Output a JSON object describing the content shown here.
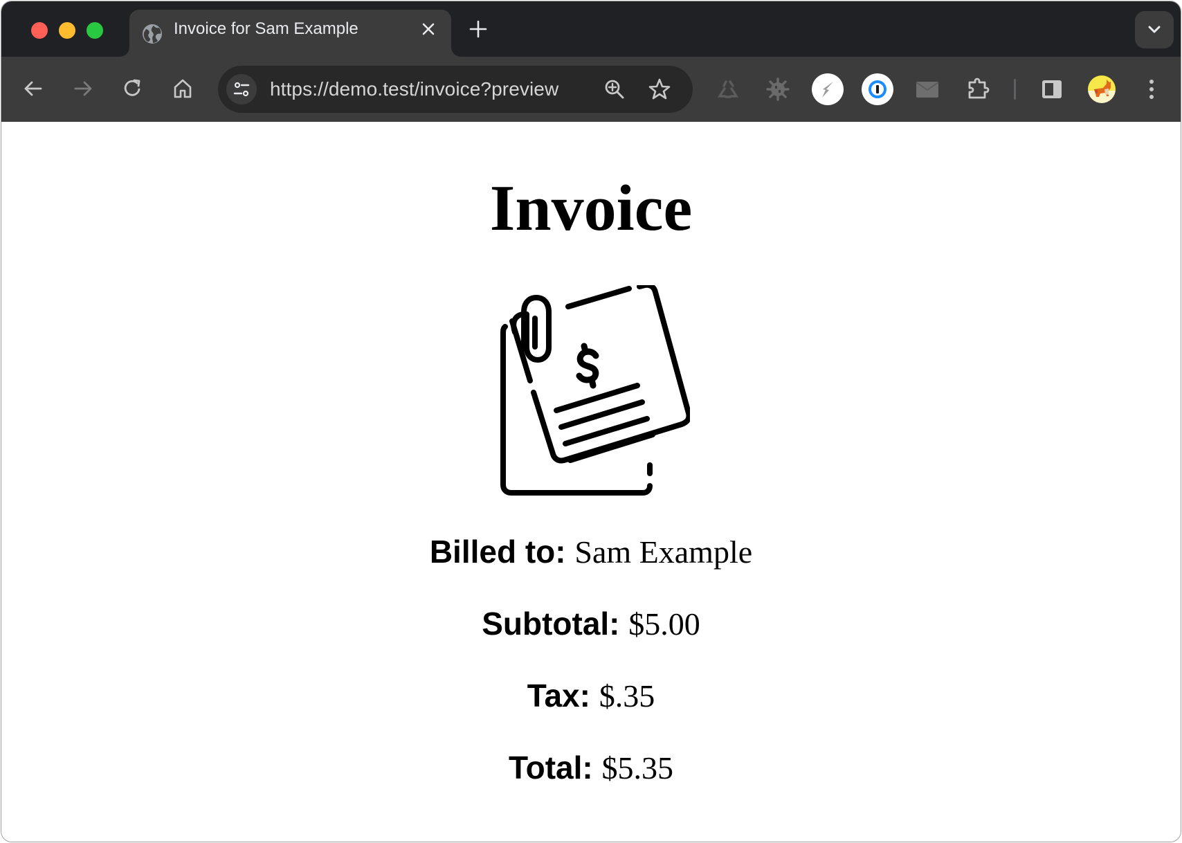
{
  "browser": {
    "tab": {
      "title": "Invoice for Sam Example",
      "favicon": "globe-icon",
      "close_glyph": "✕"
    },
    "new_tab_glyph": "+",
    "toolbar": {
      "back": "arrow-left-icon",
      "forward": "arrow-right-icon",
      "reload": "reload-icon",
      "home": "home-icon"
    },
    "omnibox": {
      "url": "https://demo.test/invoice?preview",
      "site_info_icon": "tune-icon",
      "zoom_icon": "zoom-in-icon",
      "bookmark_icon": "star-icon"
    },
    "extensions": [
      {
        "name": "recycle-extension",
        "icon": "recycle-icon"
      },
      {
        "name": "bug-extension",
        "icon": "bug-icon"
      },
      {
        "name": "lightning-extension",
        "icon": "lightning-icon"
      },
      {
        "name": "password-manager-extension",
        "icon": "onepassword-icon"
      },
      {
        "name": "mail-extension",
        "icon": "mail-icon"
      },
      {
        "name": "extensions-menu",
        "icon": "puzzle-icon"
      }
    ],
    "side_panel_icon": "side-panel-icon",
    "profile_avatar": "corgi-avatar",
    "menu_icon": "kebab-menu-icon",
    "colors": {
      "titlebar": "#202124",
      "toolbar": "#3c3c3c",
      "omnibox": "#282828",
      "text": "#e8eaed"
    }
  },
  "page": {
    "title": "Invoice",
    "icon": "invoice-document-icon",
    "fields": {
      "billed_to": {
        "label": "Billed to:",
        "value": "Sam Example"
      },
      "subtotal": {
        "label": "Subtotal:",
        "value": "$5.00"
      },
      "tax": {
        "label": "Tax:",
        "value": "$.35"
      },
      "total": {
        "label": "Total:",
        "value": "$5.35"
      }
    }
  }
}
